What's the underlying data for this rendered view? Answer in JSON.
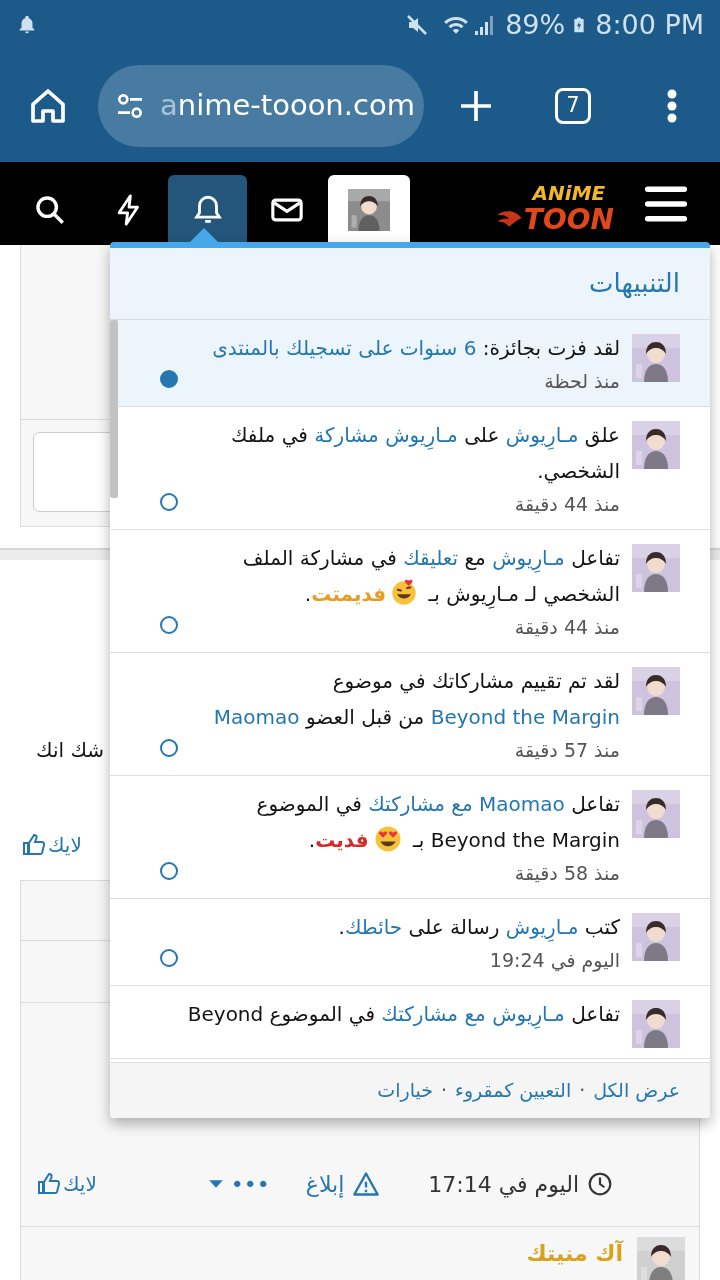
{
  "status_bar": {
    "battery": "89%",
    "time": "8:00 PM"
  },
  "browser": {
    "url": "anime-tooon.com",
    "tab_count": "7"
  },
  "site_header": {
    "logo_top": "ANiME",
    "logo_bottom": "TOON",
    "nav": [
      {
        "kind": "search",
        "selected": false
      },
      {
        "kind": "whats_new",
        "selected": false
      },
      {
        "kind": "alerts",
        "selected": true
      },
      {
        "kind": "inbox",
        "selected": false
      },
      {
        "kind": "account",
        "selected": false
      }
    ]
  },
  "page": {
    "snippet": "شك انك",
    "like_label": "لايك",
    "post_time": "اليوم في 17:14",
    "report": "إبلاغ",
    "more": "•••",
    "like_label_2": "لايك",
    "next_author": "آك منيتك"
  },
  "alerts_popup": {
    "title": "التنبيهات",
    "notifications": [
      {
        "unread": true,
        "segments": [
          {
            "kind": "text",
            "text": "لقد فزت بجائزة: "
          },
          {
            "kind": "link",
            "text": "6 سنوات على تسجيلك بالمنتدى"
          }
        ],
        "time": "منذ لحظة"
      },
      {
        "unread": false,
        "segments": [
          {
            "kind": "text",
            "text": "علق "
          },
          {
            "kind": "link",
            "text": "مـارِيوش"
          },
          {
            "kind": "text",
            "text": " على "
          },
          {
            "kind": "link",
            "text": "مـارِيوش مشاركة"
          },
          {
            "kind": "text",
            "text": " في ملفك الشخصي."
          }
        ],
        "time": "منذ 44 دقيقة"
      },
      {
        "unread": false,
        "segments": [
          {
            "kind": "text",
            "text": "تفاعل "
          },
          {
            "kind": "link",
            "text": "مـارِيوش"
          },
          {
            "kind": "text",
            "text": " مع "
          },
          {
            "kind": "link",
            "text": "تعليقك"
          },
          {
            "kind": "text",
            "text": " في مشاركة الملف الشخصي لـ مـارِيوش بـ "
          },
          {
            "kind": "emoji_laugh"
          },
          {
            "kind": "reaction",
            "text": "فديمتت",
            "color": "#e99c1f"
          },
          {
            "kind": "text",
            "text": "."
          }
        ],
        "time": "منذ 44 دقيقة"
      },
      {
        "unread": false,
        "segments": [
          {
            "kind": "text",
            "text": "لقد تم تقييم مشاركاتك في موضوع "
          },
          {
            "kind": "link",
            "text": "Beyond the Margin"
          },
          {
            "kind": "text",
            "text": " من قبل العضو "
          },
          {
            "kind": "link",
            "text": "Maomao"
          }
        ],
        "time": "منذ 57 دقيقة"
      },
      {
        "unread": false,
        "segments": [
          {
            "kind": "text",
            "text": "تفاعل "
          },
          {
            "kind": "link",
            "text": "Maomao مع مشاركتك"
          },
          {
            "kind": "text",
            "text": " في الموضوع Beyond the Margin بـ "
          },
          {
            "kind": "emoji_hearts"
          },
          {
            "kind": "reaction",
            "text": "فديت",
            "color": "#d42a2a"
          },
          {
            "kind": "text",
            "text": "."
          }
        ],
        "time": "منذ 58 دقيقة"
      },
      {
        "unread": false,
        "segments": [
          {
            "kind": "text",
            "text": "كتب "
          },
          {
            "kind": "link",
            "text": "مـارِيوش"
          },
          {
            "kind": "text",
            "text": " رسالة على "
          },
          {
            "kind": "link",
            "text": "حائطك"
          },
          {
            "kind": "text",
            "text": "."
          }
        ],
        "time": "اليوم في 19:24"
      },
      {
        "segments": [
          {
            "kind": "text",
            "text": "تفاعل "
          },
          {
            "kind": "link",
            "text": "مـارِيوش مع مشاركتك"
          },
          {
            "kind": "text",
            "text": " في الموضوع Beyond"
          }
        ]
      }
    ],
    "footer": {
      "links": [
        "عرض الكل",
        "التعيين كمقروء",
        "خيارات"
      ],
      "separator": "·"
    }
  }
}
